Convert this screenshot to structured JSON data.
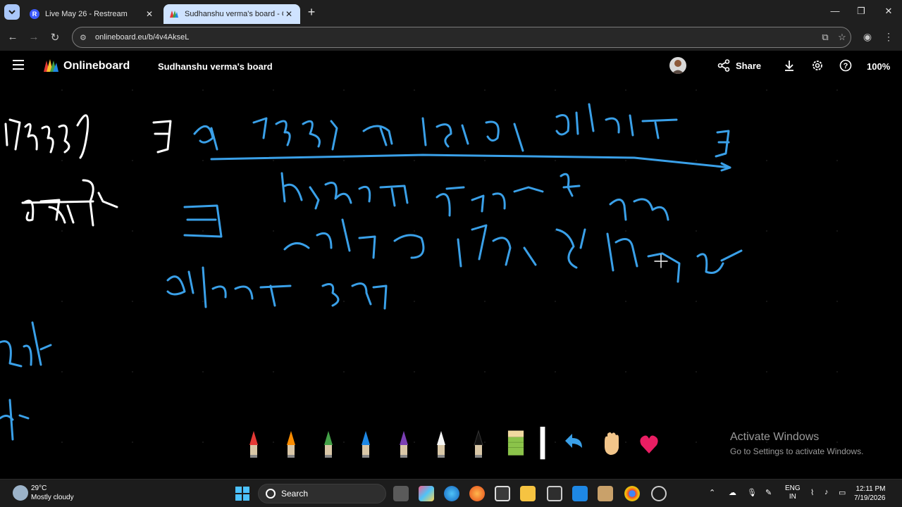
{
  "browser": {
    "tabs": [
      {
        "title": "Live May 26 - Restream",
        "favicon": "restream-icon",
        "active": false
      },
      {
        "title": "Sudhanshu verma's board - Onl",
        "favicon": "onlineboard-icon",
        "active": true
      }
    ],
    "url": "onlineboard.eu/b/4v4AkseL"
  },
  "app": {
    "brand": "Onlineboard",
    "board_name": "Sudhanshu verma's board",
    "share_label": "Share",
    "zoom": "100%"
  },
  "tools": [
    "red-marker",
    "orange-marker",
    "green-marker",
    "blue-marker",
    "purple-marker",
    "white-marker",
    "black-marker",
    "eraser",
    "line-width",
    "undo-arrow",
    "hand-pan",
    "heart-reaction"
  ],
  "watermark": {
    "title": "Activate Windows",
    "subtitle": "Go to Settings to activate Windows."
  },
  "taskbar": {
    "weather_temp": "29°C",
    "weather_desc": "Mostly cloudy",
    "search_label": "Search",
    "lang_top": "ENG",
    "lang_bottom": "IN",
    "time": "12:11 PM",
    "date": "7/19/2026"
  },
  "colors": {
    "ink_blue": "#3aa0e8",
    "ink_white": "#ffffff",
    "active_tab": "#cfe3ff"
  }
}
